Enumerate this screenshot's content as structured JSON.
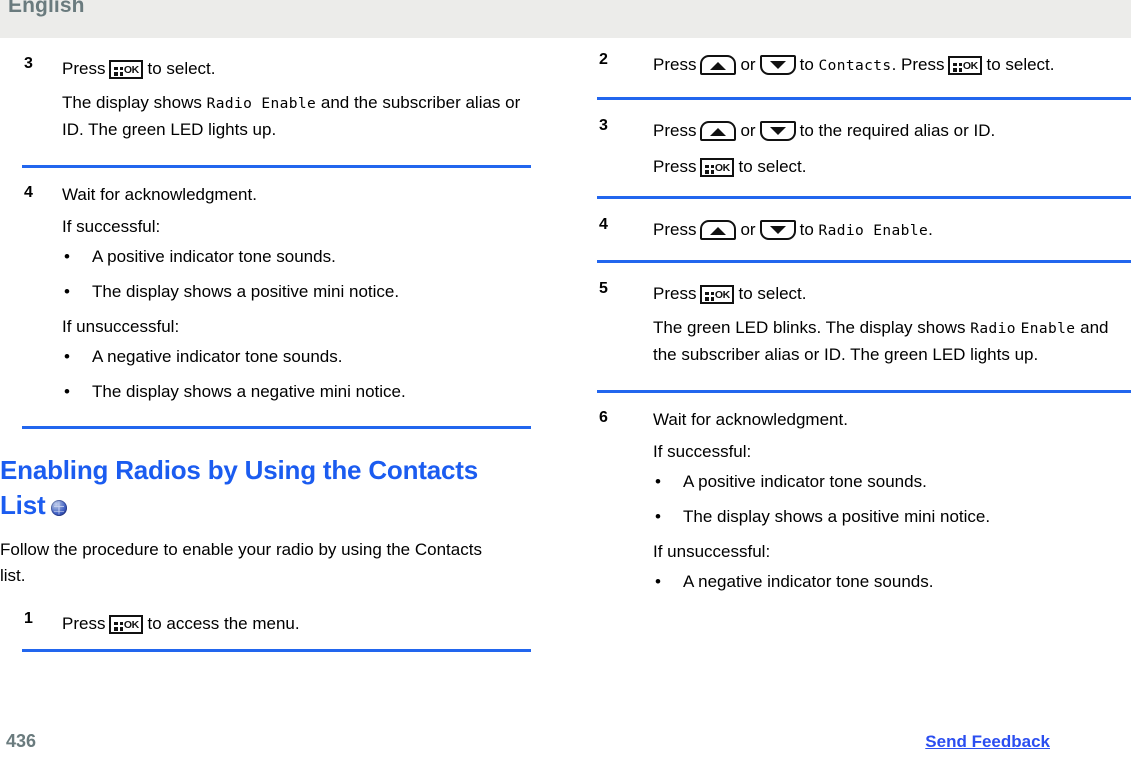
{
  "header": {
    "language_label": "English"
  },
  "footer": {
    "page_number": "436",
    "send_feedback_label": "Send Feedback"
  },
  "icons": {
    "ok_key": "ok-menu-key-icon",
    "up_key": "up-arrow-key-icon",
    "down_key": "down-arrow-key-icon",
    "globe": "globe-icon"
  },
  "colors": {
    "rule_blue": "#2266ee",
    "heading_blue": "#1b5cf0",
    "link_blue": "#2b4ef0",
    "header_band": "#ececea",
    "header_text": "#6a7b7e"
  },
  "left_column": {
    "step3": {
      "number": "3",
      "press_prefix": "Press",
      "press_suffix": "to select.",
      "detail_1": "The display shows",
      "detail_display": "Radio Enable",
      "detail_2": "and the subscriber alias or ID. The green LED lights up."
    },
    "step4": {
      "number": "4",
      "title": "Wait for acknowledgment.",
      "success_label": "If successful:",
      "success_bullets": [
        "A positive indicator tone sounds.",
        "The display shows a positive mini notice."
      ],
      "fail_label": "If unsuccessful:",
      "fail_bullets": [
        "A negative indicator tone sounds.",
        "The display shows a negative mini notice."
      ]
    },
    "section": {
      "heading_line1": "Enabling Radios by Using the Contacts",
      "heading_line2": "List",
      "intro": "Follow the procedure to enable your radio by using the Contacts list."
    },
    "step1": {
      "number": "1",
      "press_prefix": "Press",
      "press_suffix": "to access the menu."
    }
  },
  "right_column": {
    "step2": {
      "number": "2",
      "press_prefix": "Press",
      "or_label": "or",
      "to_label": "to",
      "target_display": "Contacts",
      "press_label": ". Press",
      "select_suffix": "to select."
    },
    "step3": {
      "number": "3",
      "press_prefix": "Press",
      "or_label": "or",
      "to_label": "to the required alias or ID.",
      "press_line": "Press",
      "press_line_suffix": "to select."
    },
    "step4": {
      "number": "4",
      "press_prefix": "Press",
      "or_label": "or",
      "to_label": "to",
      "target_display": "Radio Enable",
      "period": "."
    },
    "step5": {
      "number": "5",
      "press_prefix": "Press",
      "press_suffix": "to select.",
      "detail_1": "The green LED blinks. The display shows",
      "detail_display_1": "Radio",
      "detail_display_2": "Enable",
      "detail_2": "and the subscriber alias or ID. The green LED lights up."
    },
    "step6": {
      "number": "6",
      "title": "Wait for acknowledgment.",
      "success_label": "If successful:",
      "success_bullets": [
        "A positive indicator tone sounds.",
        "The display shows a positive mini notice."
      ],
      "fail_label": "If unsuccessful:",
      "fail_bullets": [
        "A negative indicator tone sounds."
      ]
    }
  },
  "bullet_char": "•"
}
